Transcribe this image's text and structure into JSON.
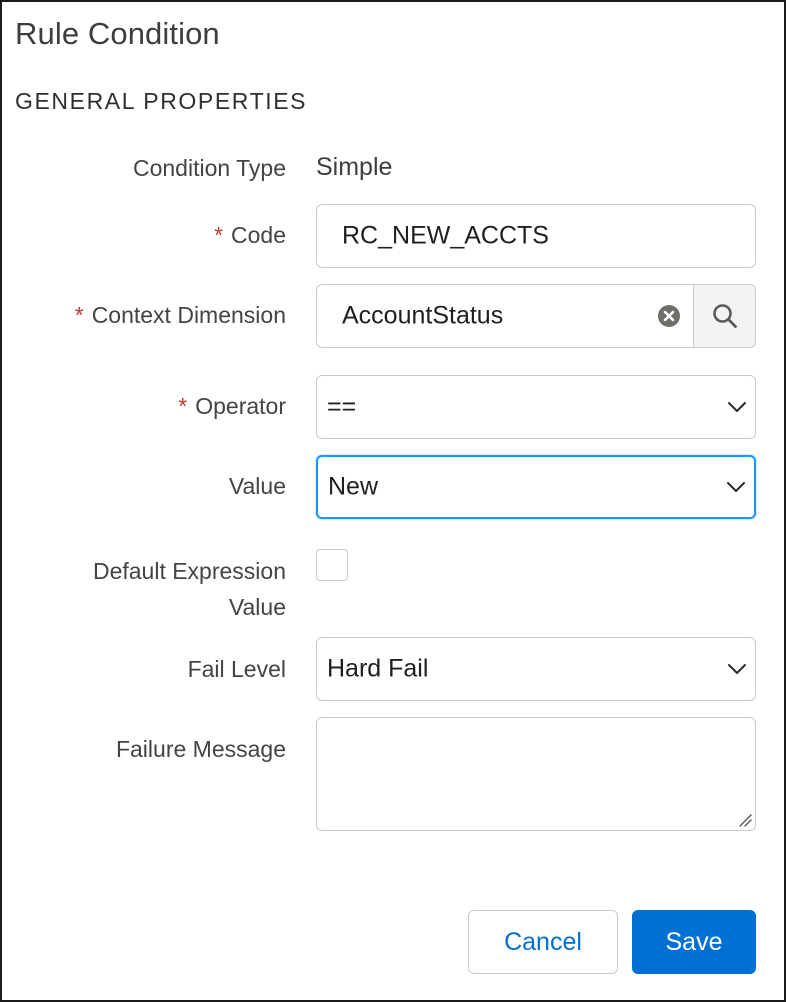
{
  "dialog": {
    "title": "Rule Condition",
    "section_header": "GENERAL PROPERTIES"
  },
  "form": {
    "condition_type": {
      "label": "Condition Type",
      "value": "Simple"
    },
    "code": {
      "required_marker": "*",
      "label": "Code",
      "value": "RC_NEW_ACCTS"
    },
    "context_dimension": {
      "required_marker": "*",
      "label": "Context Dimension",
      "value": "AccountStatus",
      "clear_icon": "close-circle-icon",
      "search_icon": "search-icon"
    },
    "operator": {
      "required_marker": "*",
      "label": "Operator",
      "selected": "=="
    },
    "value": {
      "label": "Value",
      "selected": "New",
      "focused": true
    },
    "default_expression_value": {
      "label_line1": "Default Expression",
      "label_line2": "Value",
      "checked": false
    },
    "fail_level": {
      "label": "Fail Level",
      "selected": "Hard Fail"
    },
    "failure_message": {
      "label": "Failure Message",
      "value": ""
    }
  },
  "footer": {
    "cancel_label": "Cancel",
    "save_label": "Save"
  },
  "colors": {
    "brand": "#0070d2",
    "required": "#c23934",
    "focus": "#1b96ff",
    "border": "#c9c9c9"
  }
}
